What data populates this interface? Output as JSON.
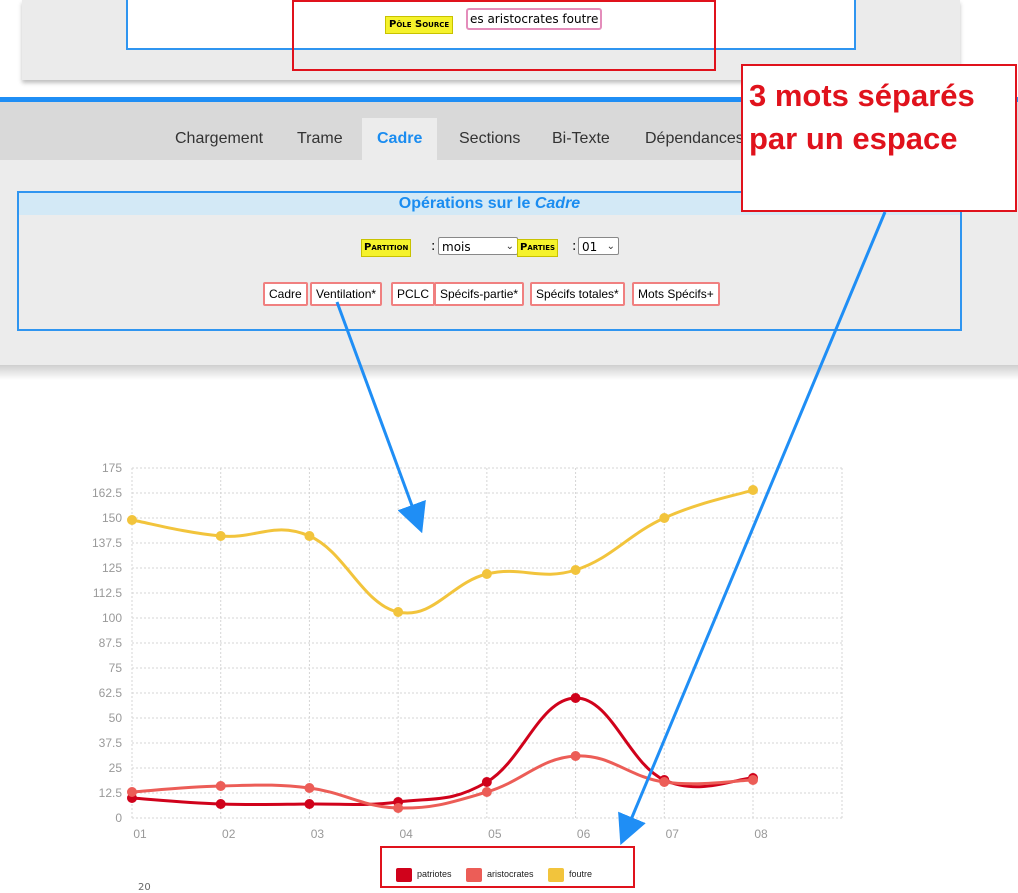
{
  "top": {
    "pole_source_label": "Pôle Source",
    "pole_source_value": "es aristocrates foutre"
  },
  "tabs": [
    {
      "label": "Chargement"
    },
    {
      "label": "Trame"
    },
    {
      "label": "Cadre"
    },
    {
      "label": "Sections"
    },
    {
      "label": "Bi-Texte"
    },
    {
      "label": "Dépendances"
    }
  ],
  "active_tab": "Cadre",
  "operations": {
    "title_prefix": "Opérations sur le ",
    "title_em": "Cadre",
    "partition_label": "Partition",
    "partition_value": "mois",
    "parties_label": "Parties",
    "parties_value": "01",
    "colon": ":",
    "buttons": [
      "Cadre",
      "Ventilation*",
      "PCLC",
      "Spécifs-partie*",
      "Spécifs totales*",
      "Mots Spécifs+"
    ]
  },
  "callout": {
    "line1": "3 mots séparés",
    "line2": "par un espace"
  },
  "colors": {
    "accent_blue": "#1f8ef5",
    "callout_red": "#e0121c",
    "highlight_yellow": "#f5f22b"
  },
  "chart_data": {
    "type": "line",
    "x": [
      "01",
      "02",
      "03",
      "04",
      "05",
      "06",
      "07",
      "08"
    ],
    "ylim": [
      0,
      175
    ],
    "yticks": [
      "0",
      "12.5",
      "25",
      "37.5",
      "50",
      "62.5",
      "75",
      "87.5",
      "100",
      "112.5",
      "125",
      "137.5",
      "150",
      "162.5",
      "175"
    ],
    "series": [
      {
        "name": "patriotes",
        "color": "#d0021b",
        "values": [
          10,
          7,
          7,
          8,
          18,
          60,
          19,
          20
        ]
      },
      {
        "name": "aristocrates",
        "color": "#ec5d57",
        "values": [
          13,
          16,
          15,
          5,
          13,
          31,
          18,
          19
        ]
      },
      {
        "name": "foutre",
        "color": "#f2c43c",
        "values": [
          149,
          141,
          141,
          103,
          122,
          124,
          150,
          164
        ]
      }
    ],
    "grid": true,
    "legend_position": "bottom"
  },
  "footer": {
    "number": "20"
  }
}
